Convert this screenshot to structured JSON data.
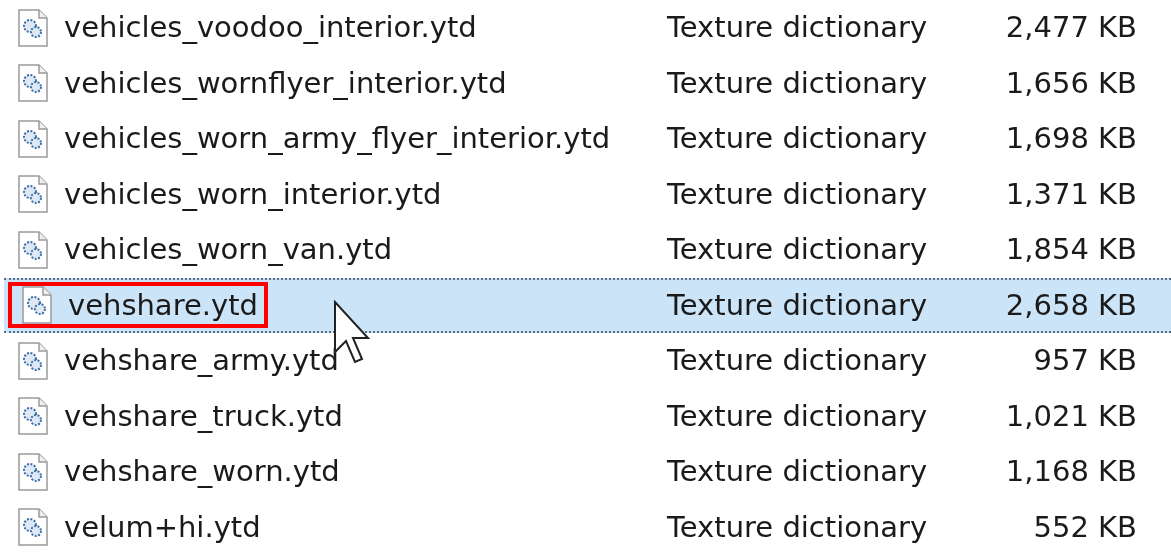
{
  "files": [
    {
      "name": "vehicles_voodoo_interior.ytd",
      "type": "Texture dictionary",
      "size": "2,477 KB",
      "selected": false,
      "highlighted": false
    },
    {
      "name": "vehicles_wornflyer_interior.ytd",
      "type": "Texture dictionary",
      "size": "1,656 KB",
      "selected": false,
      "highlighted": false
    },
    {
      "name": "vehicles_worn_army_flyer_interior.ytd",
      "type": "Texture dictionary",
      "size": "1,698 KB",
      "selected": false,
      "highlighted": false
    },
    {
      "name": "vehicles_worn_interior.ytd",
      "type": "Texture dictionary",
      "size": "1,371 KB",
      "selected": false,
      "highlighted": false
    },
    {
      "name": "vehicles_worn_van.ytd",
      "type": "Texture dictionary",
      "size": "1,854 KB",
      "selected": false,
      "highlighted": false
    },
    {
      "name": "vehshare.ytd",
      "type": "Texture dictionary",
      "size": "2,658 KB",
      "selected": true,
      "highlighted": true
    },
    {
      "name": "vehshare_army.ytd",
      "type": "Texture dictionary",
      "size": "957 KB",
      "selected": false,
      "highlighted": false
    },
    {
      "name": "vehshare_truck.ytd",
      "type": "Texture dictionary",
      "size": "1,021 KB",
      "selected": false,
      "highlighted": false
    },
    {
      "name": "vehshare_worn.ytd",
      "type": "Texture dictionary",
      "size": "1,168 KB",
      "selected": false,
      "highlighted": false
    },
    {
      "name": "velum+hi.ytd",
      "type": "Texture dictionary",
      "size": "552 KB",
      "selected": false,
      "highlighted": false
    }
  ]
}
